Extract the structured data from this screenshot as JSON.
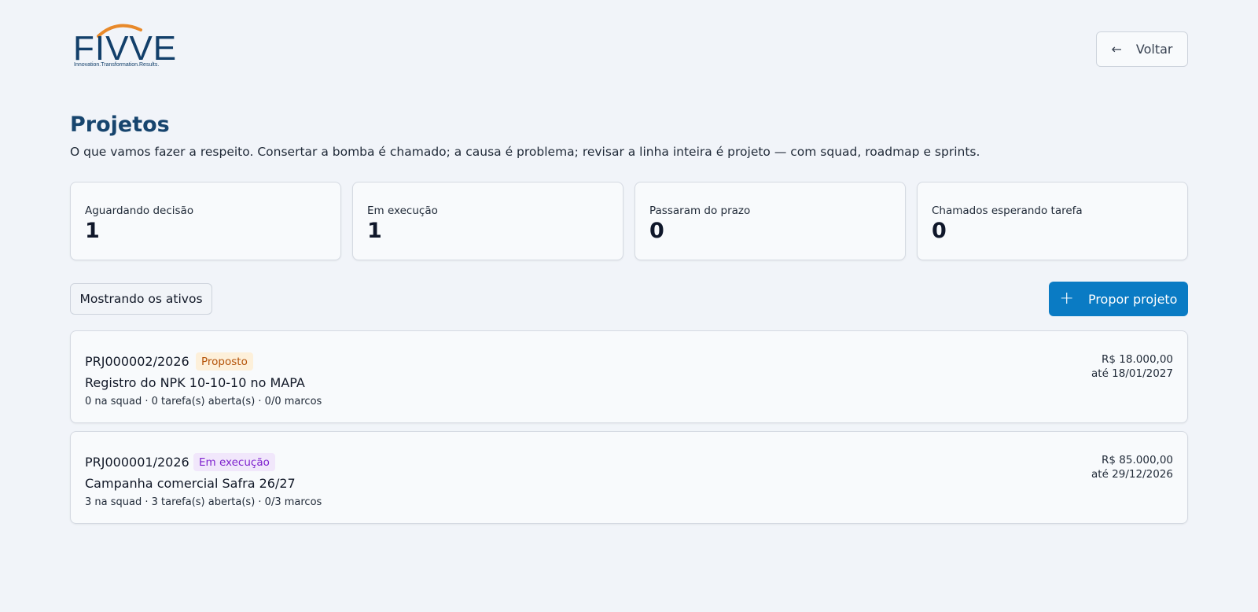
{
  "brand": {
    "name": "FIVVE",
    "tagline": "Innovation.Transformation.Results.",
    "colors": {
      "primary": "#123f6a",
      "arc": "#e8892a"
    }
  },
  "header": {
    "back_label": "Voltar",
    "back_icon": "arrow-left-icon"
  },
  "page": {
    "title": "Projetos",
    "subtitle": "O que vamos fazer a respeito. Consertar a bomba é chamado; a causa é problema; revisar a linha inteira é projeto — com squad, roadmap e sprints."
  },
  "stats": [
    {
      "label": "Aguardando decisão",
      "value": "1"
    },
    {
      "label": "Em execução",
      "value": "1"
    },
    {
      "label": "Passaram do prazo",
      "value": "0"
    },
    {
      "label": "Chamados esperando tarefa",
      "value": "0"
    }
  ],
  "toolbar": {
    "filter_label": "Mostrando os ativos",
    "propose_label": "Propor projeto",
    "propose_icon": "plus-icon",
    "accent": "#0a7bc4"
  },
  "projects": [
    {
      "code": "PRJ000002/2026",
      "status": "Proposto",
      "name": "Registro do NPK 10-10-10 no MAPA",
      "meta": "0 na squad · 0 tarefa(s) aberta(s) · 0/0 marcos",
      "value": "R$ 18.000,00",
      "due": "até 18/01/2027"
    },
    {
      "code": "PRJ000001/2026",
      "status": "Em execução",
      "name": "Campanha comercial Safra 26/27",
      "meta": "3 na squad · 3 tarefa(s) aberta(s) · 0/3 marcos",
      "value": "R$ 85.000,00",
      "due": "até 29/12/2026"
    }
  ]
}
